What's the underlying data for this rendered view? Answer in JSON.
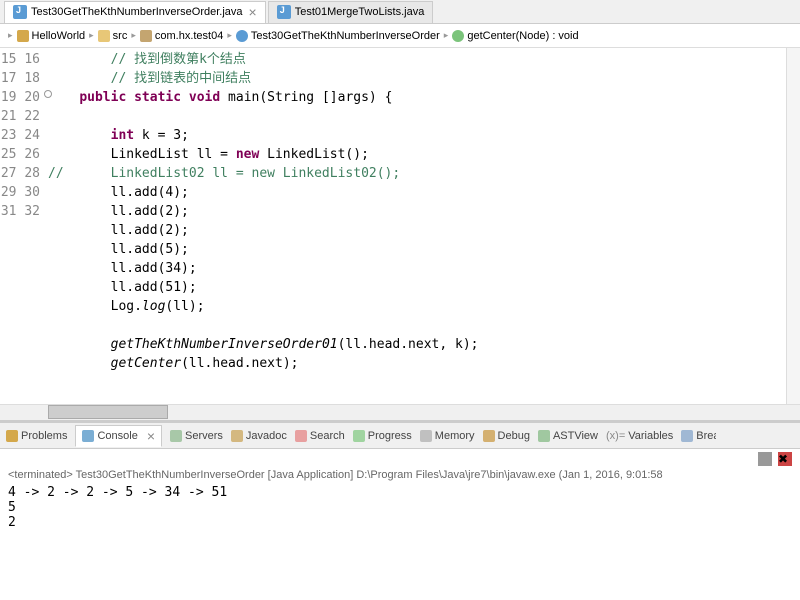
{
  "tabs": [
    {
      "label": "Test30GetTheKthNumberInverseOrder.java",
      "active": true
    },
    {
      "label": "Test01MergeTwoLists.java",
      "active": false
    }
  ],
  "breadcrumb": [
    {
      "label": "HelloWorld",
      "icon": "project"
    },
    {
      "label": "src",
      "icon": "folder"
    },
    {
      "label": "com.hx.test04",
      "icon": "package"
    },
    {
      "label": "Test30GetTheKthNumberInverseOrder",
      "icon": "class"
    },
    {
      "label": "getCenter(Node) : void",
      "icon": "method"
    }
  ],
  "code": {
    "first_line": 15,
    "lines": [
      "        // 找到倒数第k个结点",
      "        // 找到链表的中间结点",
      "    public static void main(String []args) {",
      "",
      "        int k = 3;",
      "        LinkedList ll = new LinkedList();",
      "//      LinkedList02 ll = new LinkedList02();",
      "        ll.add(4);",
      "        ll.add(2);",
      "        ll.add(2);",
      "        ll.add(5);",
      "        ll.add(34);",
      "        ll.add(51);",
      "        Log.log(ll);",
      "",
      "        getTheKthNumberInverseOrder01(ll.head.next, k);",
      "        getCenter(ll.head.next);",
      ""
    ]
  },
  "bottom_tabs": [
    "Problems",
    "Console",
    "Servers",
    "Javadoc",
    "Search",
    "Progress",
    "Memory",
    "Debug",
    "ASTView",
    "Variables",
    "Breakpoints"
  ],
  "active_bottom_tab": "Console",
  "console": {
    "status": "<terminated> Test30GetTheKthNumberInverseOrder [Java Application] D:\\Program Files\\Java\\jre7\\bin\\javaw.exe (Jan 1, 2016, 9:01:58",
    "output": "4 -> 2 -> 2 -> 5 -> 34 -> 51\n5\n2"
  }
}
